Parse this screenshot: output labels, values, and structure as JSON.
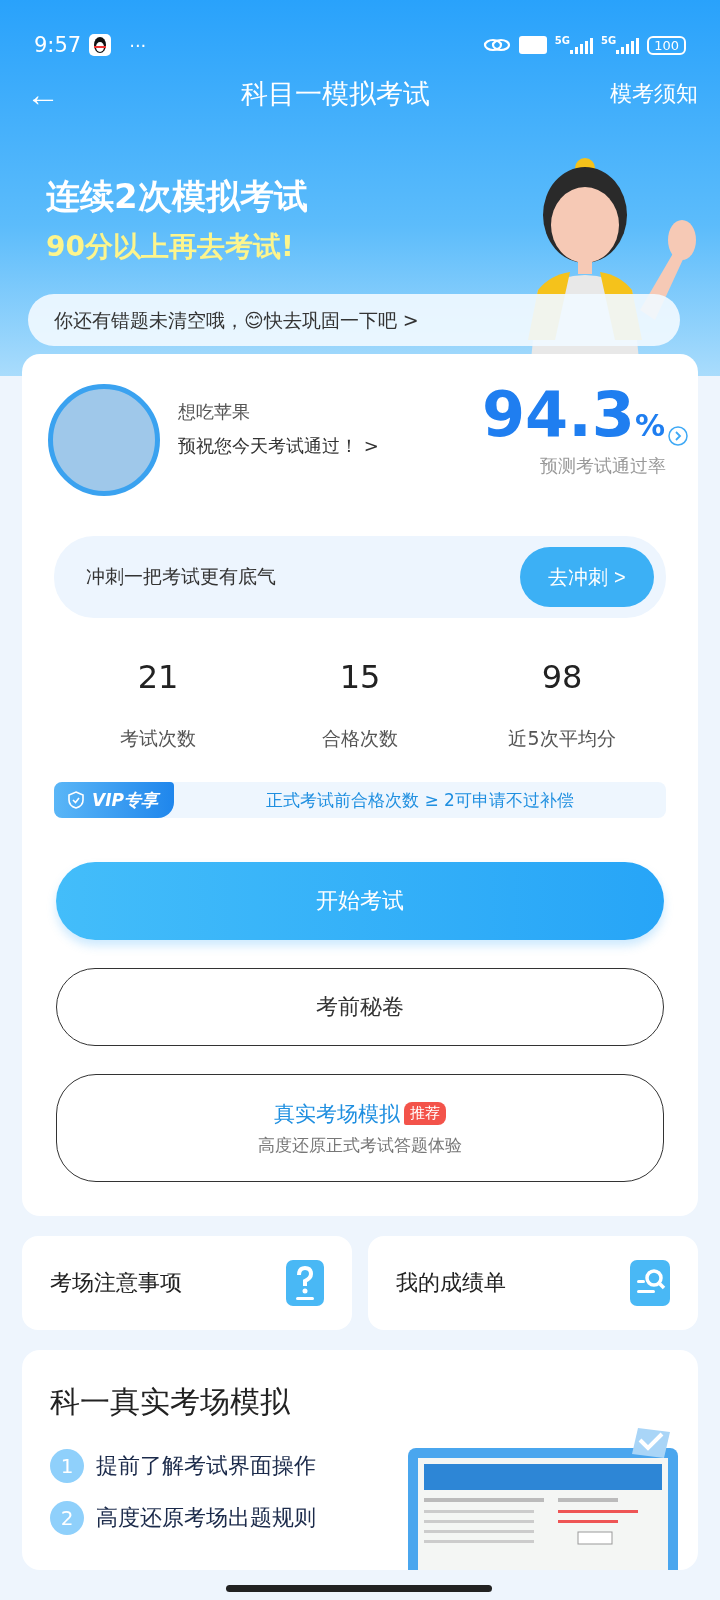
{
  "status_bar": {
    "time": "9:57",
    "more": "···",
    "battery": "100",
    "networks": [
      "5G",
      "5G"
    ]
  },
  "nav": {
    "back": "←",
    "title": "科目一模拟考试",
    "action": "模考须知"
  },
  "banner": {
    "line1": "连续2次模拟考试",
    "line2": "90分以上再去考试!",
    "tip": "你还有错题未清空哦，😊快去巩固一下吧 >"
  },
  "profile": {
    "name": "想吃苹果",
    "wish": "预祝您今天考试通过！ >",
    "rate": "94.3",
    "rate_unit": "%",
    "rate_label": "预测考试通过率"
  },
  "sprint": {
    "text": "冲刺一把考试更有底气",
    "button": "去冲刺 >"
  },
  "stats": [
    {
      "value": "21",
      "label": "考试次数"
    },
    {
      "value": "15",
      "label": "合格次数"
    },
    {
      "value": "98",
      "label": "近5次平均分"
    }
  ],
  "vip": {
    "badge": "VIP专享",
    "text": "正式考试前合格次数 ≥ 2可申请不过补偿"
  },
  "buttons": [
    {
      "kind": "primary",
      "label": "开始考试"
    },
    {
      "kind": "outline",
      "label": "考前秘卷"
    },
    {
      "kind": "outline",
      "label": "真实考场模拟",
      "tag": "推荐",
      "subtitle": "高度还原正式考试答题体验"
    }
  ],
  "shortcuts": [
    {
      "kind": "question",
      "label": "考场注意事项"
    },
    {
      "kind": "search",
      "label": "我的成绩单"
    }
  ],
  "simulation": {
    "title": "科一真实考场模拟",
    "items": [
      {
        "number": "1",
        "text": "提前了解考试界面操作"
      },
      {
        "number": "2",
        "text": "高度还原考场出题规则"
      }
    ]
  }
}
